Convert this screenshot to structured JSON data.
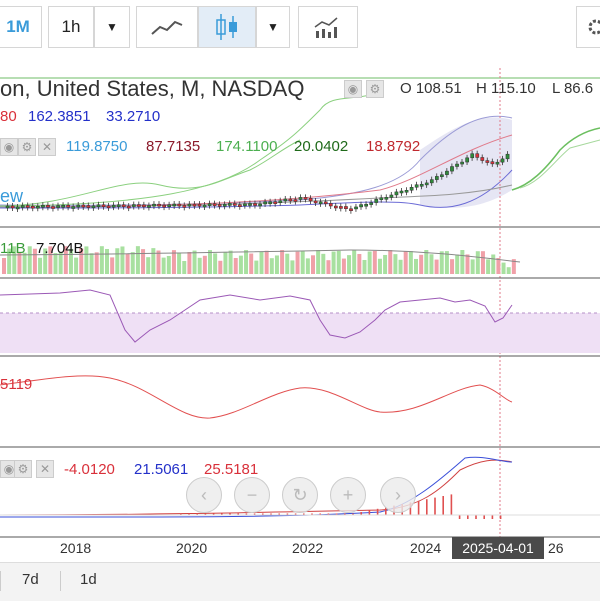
{
  "toolbar": {
    "interval_1m": "1M",
    "interval_1h": "1h",
    "dropdown_glyph": "▼",
    "line_chart_icon": "line-chart-icon",
    "candlestick_icon": "candlestick-icon",
    "indicators_icon": "indicators-icon"
  },
  "header": {
    "symbol_title": "on, United States, M, NASDAQ",
    "ohlc_o": "O 108.51",
    "ohlc_h": "H 115.10",
    "ohlc_l": "L 86.6"
  },
  "legends": {
    "bb": {
      "v1": "80",
      "v2": "162.3851",
      "v3": "33.2710"
    },
    "ma": {
      "v1": "119.8750",
      "v2": "87.7135",
      "v3": "174.1100",
      "v4": "20.0402",
      "v5": "18.8792"
    },
    "view_label": "ew",
    "volume": {
      "v1": "11B",
      "v2": "7.704B"
    },
    "stoch": {
      "v1": "5119"
    },
    "macd": {
      "v1": "-4.0120",
      "v2": "21.5061",
      "v3": "25.5181"
    }
  },
  "xaxis": {
    "labels": [
      "2018",
      "2020",
      "2022",
      "2024",
      "26"
    ],
    "crosshair_date": "2025-04-01"
  },
  "nav_controls": {
    "prev": "‹",
    "zoom_out": "−",
    "reset": "↻",
    "zoom_in": "+",
    "next": "›"
  },
  "bottom": {
    "periods": [
      "7d",
      "1d"
    ]
  },
  "colors": {
    "up": "#2e8b3a",
    "down": "#d9303a",
    "accent": "#3a9bd9",
    "purple_fill": "#efe0f5"
  }
}
